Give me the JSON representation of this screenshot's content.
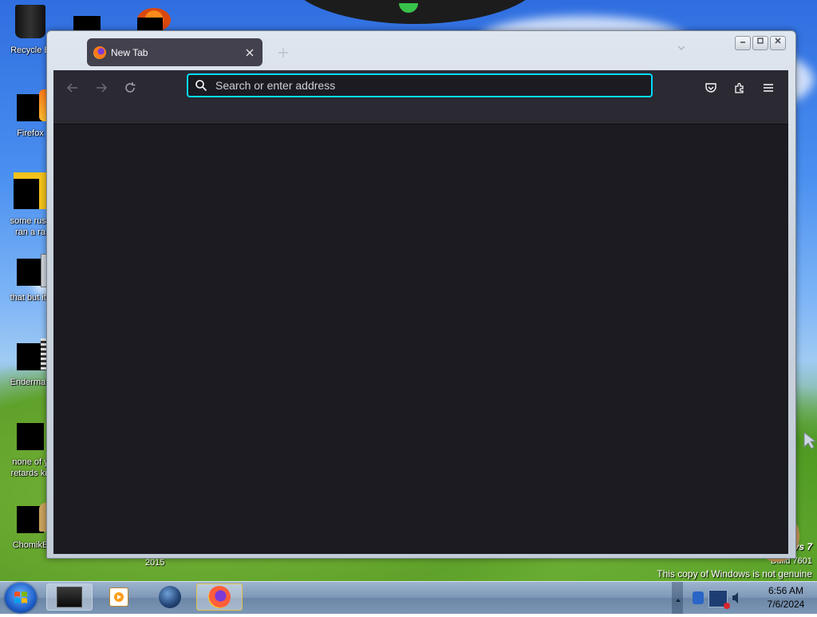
{
  "desktop": {
    "icons": [
      {
        "label": "Recycle B",
        "icon": "recycle-bin-icon"
      },
      {
        "label": "Firefox",
        "icon": "firefox-icon"
      },
      {
        "label": "some russ\nran a ra",
        "icon": "document-icon"
      },
      {
        "label": "that but its",
        "icon": "folder-icon"
      },
      {
        "label": "Enderman",
        "icon": "document-icon"
      },
      {
        "label": "none of y\nretards kn",
        "icon": "app-icon"
      },
      {
        "label": "ChomikB",
        "icon": "hamster-icon"
      }
    ],
    "year_label": "2015",
    "watermark": {
      "edition": "vs 7",
      "build": "Build 7601",
      "genuine_notice": "This copy of Windows is not genuine"
    }
  },
  "browser": {
    "tab_title": "New Tab",
    "tab_icon": "firefox-icon",
    "url_placeholder": "Search or enter address",
    "url_value": "",
    "colors": {
      "toolbar": "#2b2a33",
      "content": "#1c1b22",
      "focus": "#00ddff"
    }
  },
  "taskbar": {
    "clock_time": "6:56 AM",
    "clock_date": "7/6/2024",
    "items": [
      "terminal-icon",
      "media-player-icon",
      "globe-icon",
      "firefox-icon"
    ]
  }
}
